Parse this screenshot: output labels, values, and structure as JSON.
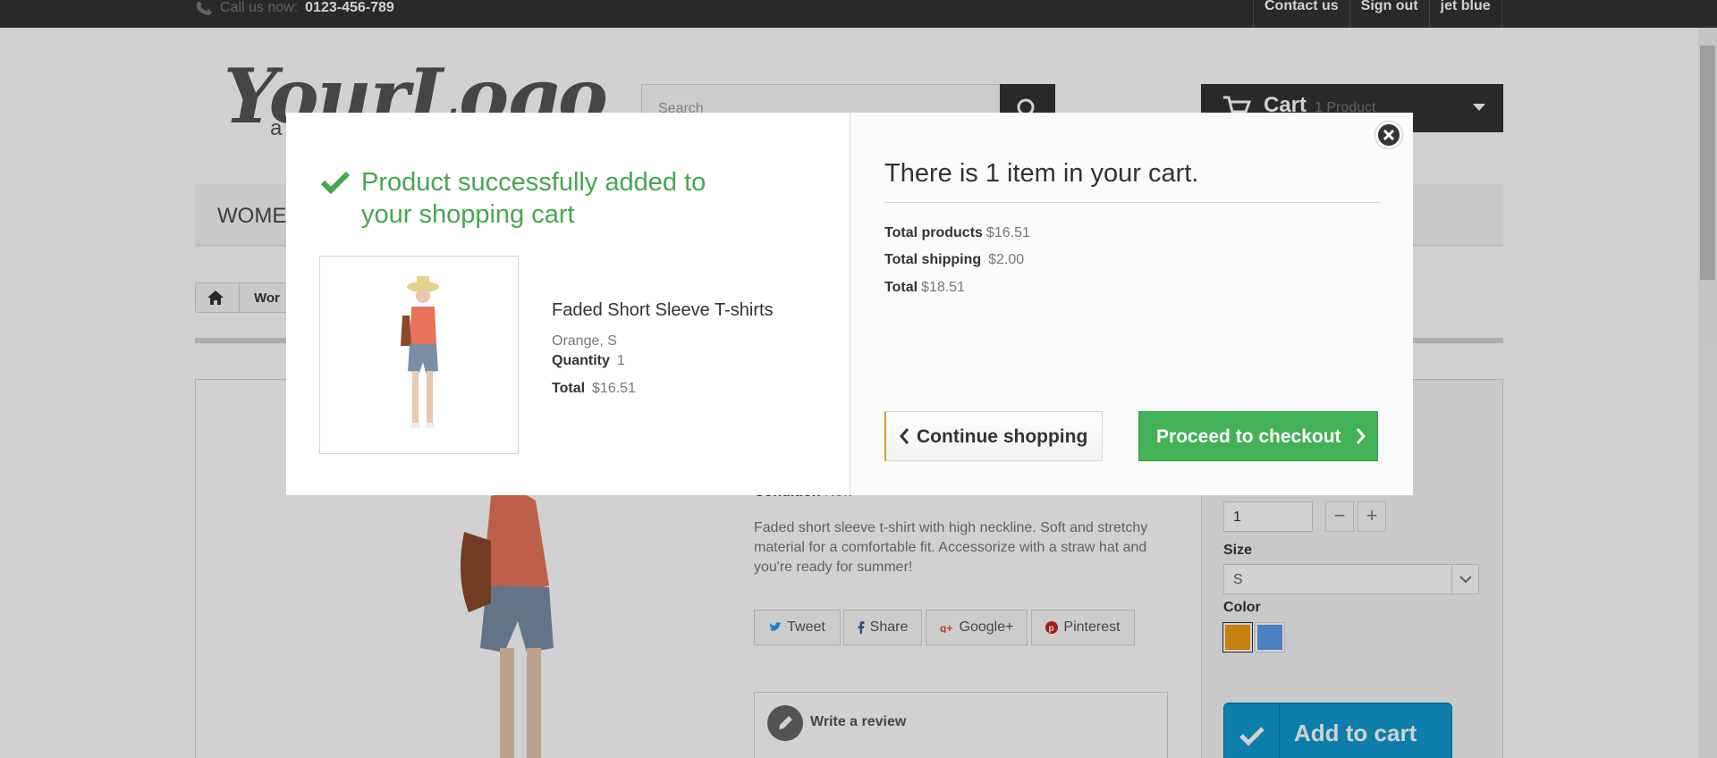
{
  "topbar": {
    "phone_label": "Call us now:",
    "phone_number": "0123-456-789",
    "links": [
      "Contact us",
      "Sign out",
      "jet blue"
    ]
  },
  "header": {
    "logo_text": "YourLogo",
    "logo_tagline": "a",
    "search_placeholder": "Search",
    "cart_label": "Cart",
    "cart_quantity": "1 Product"
  },
  "menu": {
    "first_item": "WOMEN"
  },
  "breadcrumb": {
    "current": "Wor"
  },
  "product": {
    "condition_label": "Condition",
    "condition_value": "New",
    "description": "Faded short sleeve t-shirt with high neckline. Soft and stretchy material for a comfortable fit. Accessorize with a straw hat and you're ready for summer!",
    "social": [
      "Tweet",
      "Share",
      "Google+",
      "Pinterest"
    ],
    "write_review": "Write a review",
    "quantity_value": "1",
    "size_label": "Size",
    "size_value": "S",
    "color_label": "Color",
    "colors": [
      "#f39c11",
      "#5d9cec"
    ],
    "add_to_cart": "Add to cart"
  },
  "modal": {
    "title": "Product successfully added to your shopping cart",
    "product_name": "Faded Short Sleeve T-shirts",
    "attributes": "Orange, S",
    "quantity_label": "Quantity",
    "quantity_value": "1",
    "total_label": "Total",
    "total_value": "$16.51",
    "cart_title": "There is 1 item in your cart.",
    "summary": {
      "products_label": "Total products",
      "products_value": "$16.51",
      "shipping_label": "Total shipping",
      "shipping_value": "$2.00",
      "total_label": "Total",
      "total_value": "$18.51"
    },
    "continue_label": "Continue shopping",
    "checkout_label": "Proceed to checkout"
  },
  "colors": {
    "success_green": "#46a74e",
    "checkout_green": "#43b155",
    "topbar": "#333333",
    "add_to_cart_blue": "#0f9acf"
  }
}
